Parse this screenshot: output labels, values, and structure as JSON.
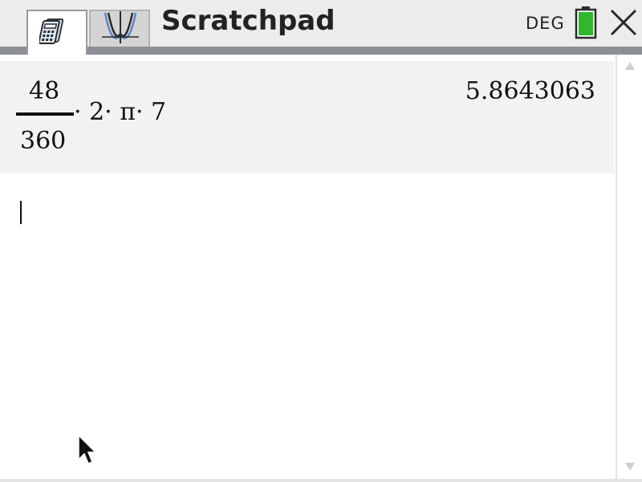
{
  "window": {
    "title": "Scratchpad",
    "angle_mode": "DEG"
  },
  "tabs": [
    {
      "name": "calculator",
      "icon": "calculator-icon",
      "active": true
    },
    {
      "name": "graph",
      "icon": "graph-icon",
      "active": false
    }
  ],
  "status": {
    "battery_icon": "battery-icon",
    "battery_color": "#2db82d",
    "close_icon": "close-icon"
  },
  "history": [
    {
      "expression": {
        "numerator": "48",
        "denominator": "360",
        "rest": "· 2· π· 7"
      },
      "result": "5.8643063"
    }
  ],
  "entry_line": {
    "value": ""
  }
}
